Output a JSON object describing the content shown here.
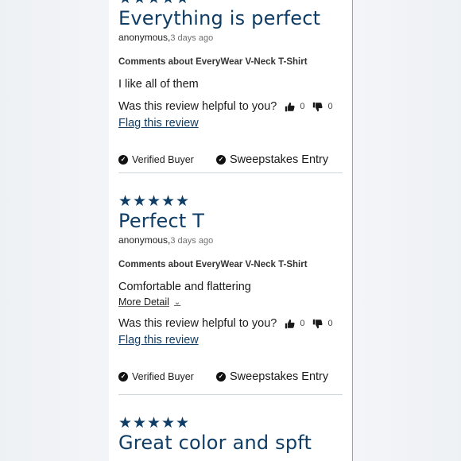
{
  "reviews": [
    {
      "stars": 5,
      "title": "Everything is perfect",
      "author": "anonymous,",
      "date": "3 days ago",
      "about": "Comments about EveryWear V-Neck T-Shirt",
      "body": "I like all of them",
      "more_detail": "",
      "helpful_prompt": "Was this review helpful to you?",
      "up_count": "0",
      "down_count": "0",
      "flag_label": "Flag this review",
      "verified_label": "Verified Buyer",
      "sweep_label": "Sweepstakes Entry"
    },
    {
      "stars": 5,
      "title": "Perfect T",
      "author": "anonymous,",
      "date": "3 days ago",
      "about": "Comments about EveryWear V-Neck T-Shirt",
      "body": "Comfortable and flattering",
      "more_detail": "More Detail",
      "helpful_prompt": "Was this review helpful to you?",
      "up_count": "0",
      "down_count": "0",
      "flag_label": "Flag this review",
      "verified_label": "Verified Buyer",
      "sweep_label": "Sweepstakes Entry"
    },
    {
      "stars": 5,
      "title": "Great color and spft"
    }
  ],
  "colors": {
    "accent": "#0f3d66",
    "divider": "#cfd4d9"
  },
  "icons": {
    "star": "star-icon",
    "thumbs_up": "thumbs-up-icon",
    "thumbs_down": "thumbs-down-icon",
    "check": "check-circle-icon",
    "chevron": "chevron-down-icon"
  }
}
